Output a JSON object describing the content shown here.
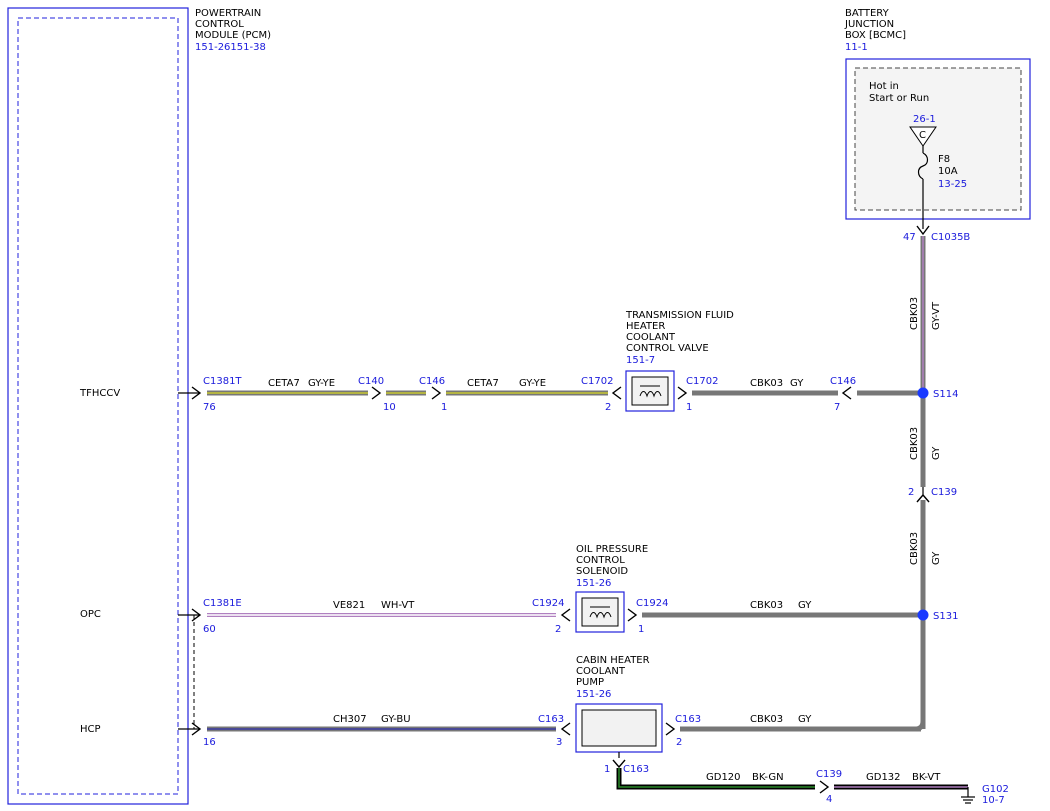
{
  "pcm": {
    "title_lines": [
      "POWERTRAIN",
      "CONTROL",
      "MODULE (PCM)"
    ],
    "ref": "151-26151-38",
    "pins": {
      "tfhccv": "TFHCCV",
      "opc": "OPC",
      "hcp": "HCP"
    }
  },
  "bjb": {
    "title_lines": [
      "BATTERY",
      "JUNCTION",
      "BOX [BCMC]"
    ],
    "ref": "11-1",
    "hot_lines": [
      "Hot in",
      "Start or Run"
    ],
    "bus_ref": "26-1",
    "bus_letter": "C",
    "fuse_name": "F8",
    "fuse_rating": "10A",
    "fuse_ref": "13-25"
  },
  "tfhccv_valve": {
    "title_lines": [
      "TRANSMISSION FLUID",
      "HEATER",
      "COOLANT",
      "CONTROL VALVE"
    ],
    "ref": "151-7"
  },
  "opc_solenoid": {
    "title_lines": [
      "OIL PRESSURE",
      "CONTROL",
      "SOLENOID"
    ],
    "ref": "151-26"
  },
  "pump": {
    "title_lines": [
      "CABIN HEATER",
      "COOLANT",
      "PUMP"
    ],
    "ref": "151-26"
  },
  "connectors": {
    "c1381t": "C1381T",
    "c1381t_pin": "76",
    "c140": "C140",
    "c140_pin": "10",
    "c146a": "C146",
    "c146a_pin": "1",
    "c1702a": "C1702",
    "c1702a_pin": "2",
    "c1702b": "C1702",
    "c1702b_pin": "1",
    "c146b": "C146",
    "c146b_pin": "7",
    "c1035b": "C1035B",
    "c1035b_pin": "47",
    "c139a": "C139",
    "c139a_pin": "2",
    "c1381e": "C1381E",
    "c1381e_pin": "60",
    "c1924a": "C1924",
    "c1924a_pin": "2",
    "c1924b": "C1924",
    "c1924b_pin": "1",
    "c163a": "C163",
    "c163a_pin": "3",
    "c163b": "C163",
    "c163b_pin": "2",
    "c163c": "C163",
    "c163c_pin": "1",
    "c139b": "C139",
    "c139b_pin": "4",
    "hcp_pin": "16"
  },
  "splices": {
    "s114": "S114",
    "s131": "S131"
  },
  "ground": {
    "name": "G102",
    "ref": "10-7"
  },
  "wires": {
    "cetA_circuit": "CETA7",
    "cetA_color": "GY-YE",
    "cetB_circuit": "CETA7",
    "cetB_color": "GY-YE",
    "cbk_a_circuit": "CBK03",
    "cbk_a_color": "GY",
    "cbk_v1_circuit": "CBK03",
    "cbk_v1_color": "GY-VT",
    "cbk_v2_circuit": "CBK03",
    "cbk_v2_color": "GY",
    "cbk_v3_circuit": "CBK03",
    "cbk_v3_color": "GY",
    "ve_circuit": "VE821",
    "ve_color": "WH-VT",
    "cbk_b_circuit": "CBK03",
    "cbk_b_color": "GY",
    "ch_circuit": "CH307",
    "ch_color": "GY-BU",
    "cbk_c_circuit": "CBK03",
    "cbk_c_color": "GY",
    "gd120_circuit": "GD120",
    "gd120_color": "BK-GN",
    "gd132_circuit": "GD132",
    "gd132_color": "BK-VT"
  },
  "colors": {
    "module": "#2222dd",
    "ref_text": "#1a1adc",
    "gy": "#777777",
    "ye": "#c8c832",
    "vt": "#b080c0",
    "wh": "#ffffff",
    "bu": "#3a3aa0",
    "bk": "#000000",
    "gn": "#2a8a2a",
    "splice": "#1a3aff"
  }
}
